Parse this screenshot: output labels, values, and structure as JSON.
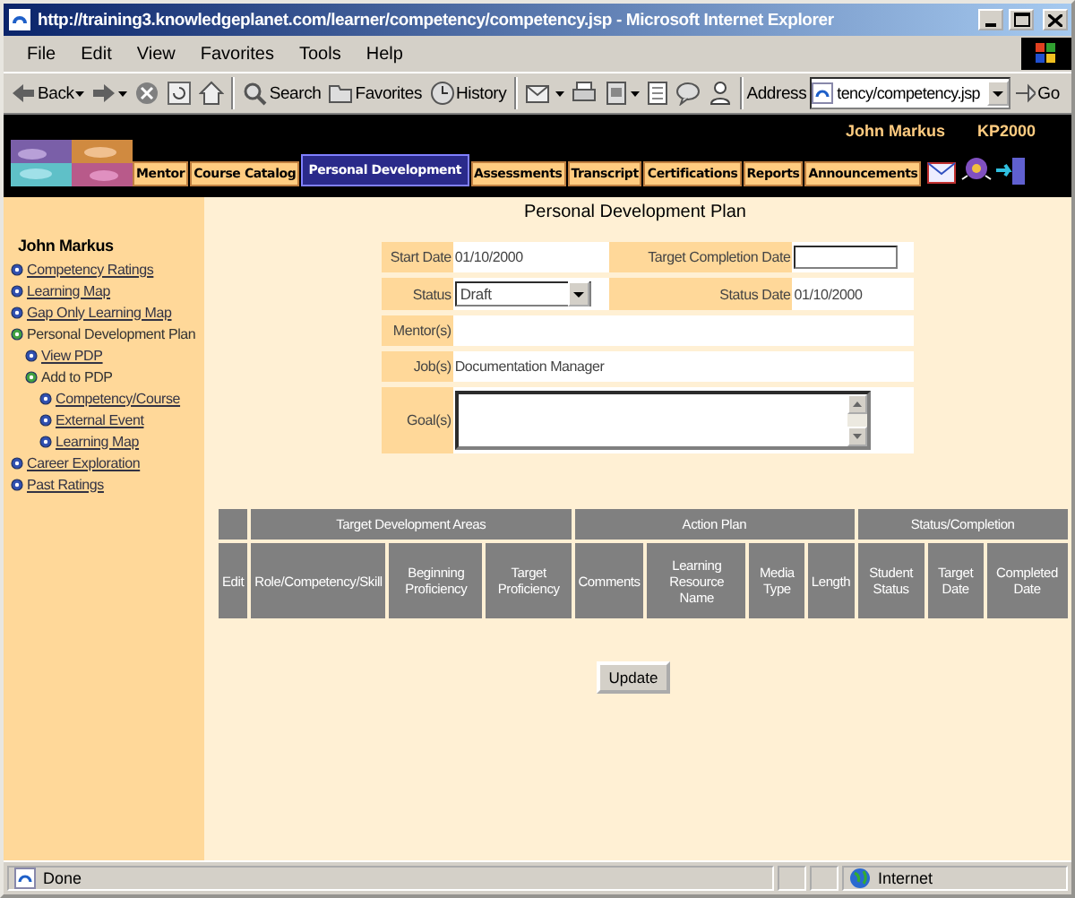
{
  "window": {
    "title": "http://training3.knowledgeplanet.com/learner/competency/competency.jsp - Microsoft Internet Explorer"
  },
  "menu": [
    "File",
    "Edit",
    "View",
    "Favorites",
    "Tools",
    "Help"
  ],
  "toolbar": {
    "back": "Back",
    "search": "Search",
    "favorites": "Favorites",
    "history": "History",
    "address_label": "Address",
    "address_value": "tency/competency.jsp",
    "go": "Go"
  },
  "banner": {
    "user": "John Markus",
    "code": "KP2000"
  },
  "nav_tabs": [
    {
      "label": "Mentor",
      "selected": false
    },
    {
      "label": "Course Catalog",
      "selected": false
    },
    {
      "label": "Personal Development",
      "selected": true
    },
    {
      "label": "Assessments",
      "selected": false
    },
    {
      "label": "Transcript",
      "selected": false
    },
    {
      "label": "Certifications",
      "selected": false
    },
    {
      "label": "Reports",
      "selected": false
    },
    {
      "label": "Announcements",
      "selected": false
    }
  ],
  "sidebar": {
    "heading": "John Markus",
    "items": [
      {
        "label": "Competency Ratings",
        "kind": "link"
      },
      {
        "label": "Learning Map",
        "kind": "link"
      },
      {
        "label": "Gap Only Learning Map",
        "kind": "link"
      },
      {
        "label": "Personal Development Plan",
        "kind": "text",
        "children": [
          {
            "label": "View PDP",
            "kind": "link"
          },
          {
            "label": "Add to PDP",
            "kind": "text",
            "children": [
              {
                "label": "Competency/Course",
                "kind": "link"
              },
              {
                "label": "External Event",
                "kind": "link"
              },
              {
                "label": "Learning Map",
                "kind": "link"
              }
            ]
          }
        ]
      },
      {
        "label": "Career Exploration",
        "kind": "link"
      },
      {
        "label": "Past Ratings",
        "kind": "link"
      }
    ]
  },
  "page_title": "Personal Development Plan",
  "form": {
    "start_date": {
      "label": "Start Date",
      "value": "01/10/2000"
    },
    "target_completion_date": {
      "label": "Target Completion Date"
    },
    "status": {
      "label": "Status",
      "value": "Draft"
    },
    "status_date": {
      "label": "Status Date",
      "value": "01/10/2000"
    },
    "mentors": {
      "label": "Mentor(s)"
    },
    "jobs": {
      "label": "Job(s)",
      "value": "Documentation Manager"
    },
    "goals": {
      "label": "Goal(s)"
    }
  },
  "plan_table": {
    "groups": [
      {
        "columns": [
          "Edit"
        ]
      },
      {
        "label": "Target Development Areas",
        "columns": [
          "Role/Competency/Skill",
          "Beginning Proficiency",
          "Target Proficiency"
        ]
      },
      {
        "label": "Action Plan",
        "columns": [
          "Comments",
          "Learning Resource Name",
          "Media Type",
          "Length"
        ]
      },
      {
        "label": "Status/Completion",
        "columns": [
          "Student Status",
          "Target Date",
          "Completed Date"
        ]
      }
    ]
  },
  "update_button": "Update",
  "status_bar": {
    "text": "Done",
    "zone": "Internet"
  }
}
